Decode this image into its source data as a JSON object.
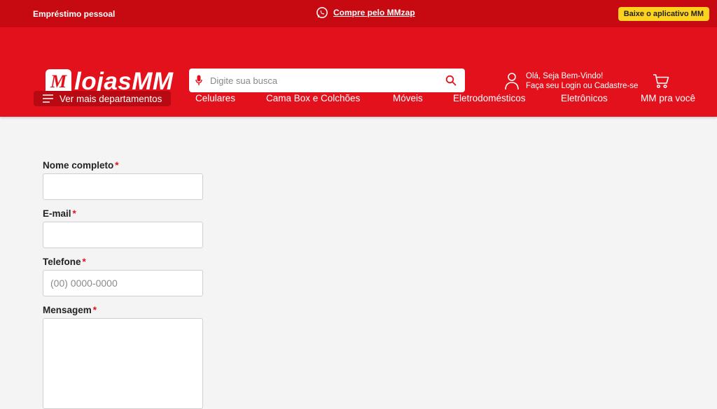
{
  "topbar": {
    "loan_label": "Empréstimo pessoal",
    "zap_label": "Compre pelo MMzap",
    "zap_icon": "whatsapp-icon",
    "app_button": "Baixe o aplicativo MM"
  },
  "header": {
    "logo_mark": "M",
    "logo_text": "lojasMM",
    "search": {
      "placeholder": "Digite sua busca",
      "value": ""
    },
    "account": {
      "greeting": "Olá, Seja Bem-Vindo!",
      "login": "Faça seu Login ou Cadastre-se"
    },
    "cart_icon": "cart-icon"
  },
  "nav": {
    "departments_label": "Ver mais departamentos",
    "items": [
      "Celulares",
      "Cama Box e Colchões",
      "Móveis",
      "Eletrodomésticos",
      "Eletrônicos",
      "MM pra você"
    ]
  },
  "form": {
    "required_mark": "*",
    "name": {
      "label": "Nome completo",
      "value": ""
    },
    "email": {
      "label": "E-mail",
      "value": ""
    },
    "phone": {
      "label": "Telefone",
      "placeholder": "(00) 0000-0000",
      "value": ""
    },
    "message": {
      "label": "Mensagem",
      "value": ""
    }
  },
  "colors": {
    "brand_red": "#e3111b",
    "topbar_red": "#c70a12",
    "app_button_yellow": "#ffd21f"
  }
}
